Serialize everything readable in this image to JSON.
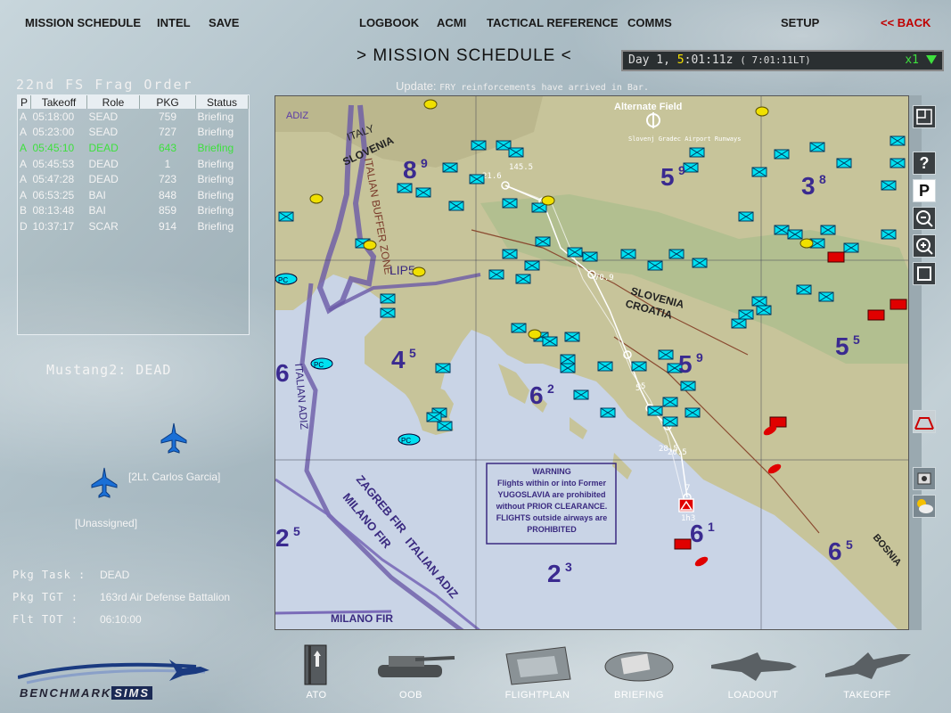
{
  "menu": {
    "mission_schedule": "MISSION SCHEDULE",
    "intel": "INTEL",
    "save": "SAVE",
    "logbook": "LOGBOOK",
    "acmi": "ACMI",
    "tactical_reference": "TACTICAL REFERENCE",
    "comms": "COMMS",
    "setup": "SETUP",
    "back": "<< BACK"
  },
  "screen_title": "> MISSION SCHEDULE <",
  "clock": {
    "day_label": "Day 1,",
    "day_hour": "5",
    "time_rest": ":01:11z",
    "local": "( 7:01:11LT)",
    "speed": "x1"
  },
  "frag": {
    "title": "22nd FS Frag Order",
    "headers": [
      "P",
      "Takeoff",
      "Role",
      "PKG",
      "Status"
    ],
    "rows": [
      {
        "p": "A",
        "takeoff": "05:18:00",
        "role": "SEAD",
        "pkg": "759",
        "status": "Briefing"
      },
      {
        "p": "A",
        "takeoff": "05:23:00",
        "role": "SEAD",
        "pkg": "727",
        "status": "Briefing"
      },
      {
        "p": "A",
        "takeoff": "05:45:10",
        "role": "DEAD",
        "pkg": "643",
        "status": "Briefing"
      },
      {
        "p": "A",
        "takeoff": "05:45:53",
        "role": "DEAD",
        "pkg": "1",
        "status": "Briefing"
      },
      {
        "p": "A",
        "takeoff": "05:47:28",
        "role": "DEAD",
        "pkg": "723",
        "status": "Briefing"
      },
      {
        "p": "A",
        "takeoff": "06:53:25",
        "role": "BAI",
        "pkg": "848",
        "status": "Briefing"
      },
      {
        "p": "B",
        "takeoff": "08:13:48",
        "role": "BAI",
        "pkg": "859",
        "status": "Briefing"
      },
      {
        "p": "D",
        "takeoff": "10:37:17",
        "role": "SCAR",
        "pkg": "914",
        "status": "Briefing"
      }
    ]
  },
  "flight": {
    "name": "Mustang2: DEAD",
    "pilot_1": "[2Lt. Carlos Garcia]",
    "pilot_2": "[Unassigned]",
    "pkg_task_label": "Pkg Task :",
    "pkg_task": "DEAD",
    "pkg_tgt_label": "Pkg TGT  :",
    "pkg_tgt": "163rd Air Defense Battalion",
    "flt_tot_label": "Flt TOT  :",
    "flt_tot": "06:10:00"
  },
  "map": {
    "update_label": "Update:",
    "update_text": "FRY reinforcements have arrived in Bar.",
    "alt_field": "Alternate Field",
    "labels": {
      "italy": "ITALY",
      "slovenia_n": "SLOVENIA",
      "slovenia": "SLOVENIA",
      "croatia": "CROATIA",
      "bosnia": "BOSNIA",
      "lip5": "LIP5",
      "adiz": "ADIZ",
      "italian_buffer": "ITALIAN BUFFER ZONE",
      "italian_adiz": "ITALIAN ADIZ",
      "zagreb_fir": "ZAGREB FIR",
      "milano_fir": "MILANO FIR",
      "italian_adiz_2": "ITALIAN ADIZ",
      "milano_fir_2": "MILANO FIR",
      "pc": "PC",
      "airport_note": "Slovenj Gradec Airport Runways"
    },
    "warning": [
      "WARNING",
      "Flights within or into Former",
      "YUGOSLAVIA are prohibited",
      "without PRIOR CLEARANCE.",
      "FLIGHTS outside airways are",
      "PROHIBITED"
    ],
    "sectors": [
      {
        "big": "8",
        "small": "9"
      },
      {
        "big": "5",
        "small": "9"
      },
      {
        "big": "3",
        "small": "8"
      },
      {
        "big": "4",
        "small": "5"
      },
      {
        "big": "6",
        "small": "2"
      },
      {
        "big": "5",
        "small": "9"
      },
      {
        "big": "5",
        "small": "5"
      },
      {
        "big": "2",
        "small": "5"
      },
      {
        "big": "2",
        "small": "3"
      },
      {
        "big": "6",
        "small": "1"
      },
      {
        "big": "6",
        "small": "5"
      },
      {
        "big": "6",
        "small": ""
      }
    ],
    "waypoints": [
      "145.5",
      "21.6",
      "5",
      "70.9",
      "5",
      "28.5",
      "20.5",
      "7",
      "1h3"
    ]
  },
  "side_buttons": {
    "help": "?",
    "p": "P"
  },
  "bottom": {
    "logo_a": "BENCHMARK",
    "logo_b": "SIMS",
    "ato": "ATO",
    "oob": "OOB",
    "flightplan": "FLIGHTPLAN",
    "briefing": "BRIEFING",
    "loadout": "LOADOUT",
    "takeoff": "TAKEOFF"
  },
  "colors": {
    "friendly": "#00e0f0",
    "enemy": "#e00000",
    "neutral": "#f0e000",
    "selected_row": "#3ee03e",
    "route": "#ffffff"
  }
}
